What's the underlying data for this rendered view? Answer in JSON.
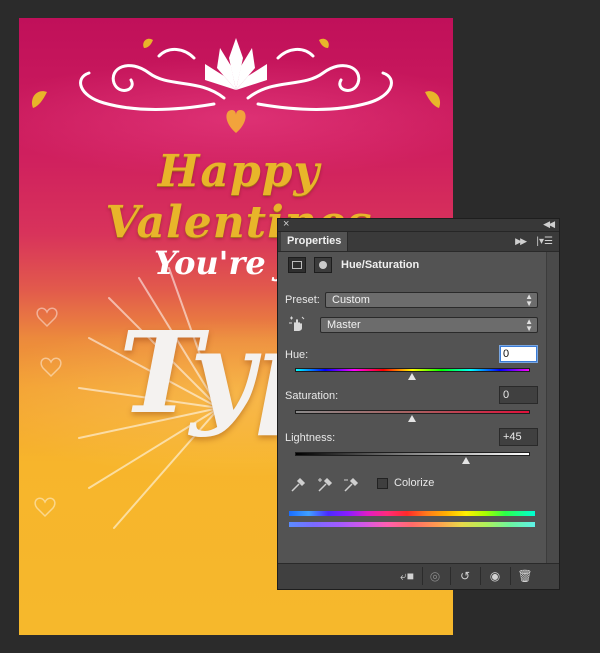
{
  "canvas": {
    "headline": "Happy Valentines",
    "subline": "You're just",
    "script_word": "Typ"
  },
  "panel": {
    "tab_label": "Properties",
    "adjustment_title": "Hue/Saturation",
    "preset_label": "Preset:",
    "preset_value": "Custom",
    "channel_value": "Master",
    "hue_label": "Hue:",
    "hue_value": "0",
    "hue_level": 0,
    "saturation_label": "Saturation:",
    "saturation_value": "0",
    "saturation_level": 0,
    "lightness_label": "Lightness:",
    "lightness_value": "+45",
    "lightness_level": 45,
    "colorize_label": "Colorize",
    "colorize_checked": false
  },
  "icons": {
    "close": "close-icon",
    "collapse": "collapse-icon",
    "panel_menu": "panel-menu-icon",
    "adjustment_layer": "adjustment-layer-icon",
    "layer_mask": "layer-mask-icon",
    "targeted_adjustment": "hand-pointer-icon",
    "eyedropper": "eyedropper-icon",
    "eyedropper_plus": "eyedropper-plus-icon",
    "eyedropper_minus": "eyedropper-minus-icon",
    "clip_to_layer": "clip-to-layer-icon",
    "view_previous": "view-previous-icon",
    "reset": "reset-icon",
    "visibility": "eye-icon",
    "delete": "trash-icon"
  },
  "colors": {
    "panel_bg": "#535353",
    "hue_ramp": "rainbow",
    "saturation_ramp": "#8a8a8a-to-#e0103a",
    "lightness_ramp": "#000000-to-#ffffff"
  }
}
